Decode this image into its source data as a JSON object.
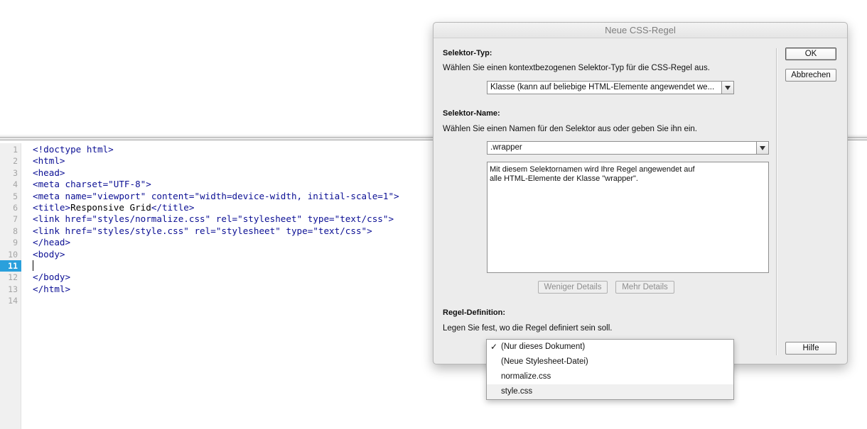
{
  "editor": {
    "line_numbers": [
      "1",
      "2",
      "3",
      "4",
      "5",
      "6",
      "7",
      "8",
      "9",
      "10",
      "11",
      "12",
      "13",
      "14"
    ],
    "current_line": "11",
    "lines": [
      [
        {
          "t": "tag",
          "v": "<!doctype html>"
        }
      ],
      [
        {
          "t": "tag",
          "v": "<html>"
        }
      ],
      [
        {
          "t": "tag",
          "v": "<head>"
        }
      ],
      [
        {
          "t": "tag",
          "v": "<meta charset="
        },
        {
          "t": "str",
          "v": "\"UTF-8\""
        },
        {
          "t": "tag",
          "v": ">"
        }
      ],
      [
        {
          "t": "tag",
          "v": "<meta name="
        },
        {
          "t": "str",
          "v": "\"viewport\""
        },
        {
          "t": "tag",
          "v": " content="
        },
        {
          "t": "str",
          "v": "\"width=device-width, initial-scale=1\""
        },
        {
          "t": "tag",
          "v": ">"
        }
      ],
      [
        {
          "t": "tag",
          "v": "<title>"
        },
        {
          "t": "text",
          "v": "Responsive Grid"
        },
        {
          "t": "tag",
          "v": "</title>"
        }
      ],
      [
        {
          "t": "tag",
          "v": "<link href="
        },
        {
          "t": "str",
          "v": "\"styles/normalize.css\""
        },
        {
          "t": "tag",
          "v": " rel="
        },
        {
          "t": "str",
          "v": "\"stylesheet\""
        },
        {
          "t": "tag",
          "v": " type="
        },
        {
          "t": "str",
          "v": "\"text/css\""
        },
        {
          "t": "tag",
          "v": ">"
        }
      ],
      [
        {
          "t": "tag",
          "v": "<link href="
        },
        {
          "t": "str",
          "v": "\"styles/style.css\""
        },
        {
          "t": "tag",
          "v": " rel="
        },
        {
          "t": "str",
          "v": "\"stylesheet\""
        },
        {
          "t": "tag",
          "v": " type="
        },
        {
          "t": "str",
          "v": "\"text/css\""
        },
        {
          "t": "tag",
          "v": ">"
        }
      ],
      [
        {
          "t": "tag",
          "v": "</head>"
        }
      ],
      [
        {
          "t": "tag",
          "v": "<body>"
        }
      ],
      [],
      [
        {
          "t": "tag",
          "v": "</body>"
        }
      ],
      [
        {
          "t": "tag",
          "v": "</html>"
        }
      ],
      []
    ]
  },
  "dialog": {
    "title": "Neue CSS-Regel",
    "selector_type": {
      "heading": "Selektor-Typ:",
      "description": "Wählen Sie einen kontextbezogenen Selektor-Typ für die CSS-Regel aus.",
      "selected": "Klasse (kann auf beliebige HTML-Elemente angewendet we..."
    },
    "selector_name": {
      "heading": "Selektor-Name:",
      "description": "Wählen Sie einen Namen für den Selektor aus oder geben Sie ihn ein.",
      "value": ".wrapper",
      "info": "Mit diesem Selektornamen wird Ihre Regel angewendet auf\nalle HTML-Elemente der Klasse \"wrapper\"."
    },
    "buttons": {
      "ok": "OK",
      "cancel": "Abbrechen",
      "less_details": "Weniger Details",
      "more_details": "Mehr Details",
      "help": "Hilfe"
    },
    "rule_definition": {
      "heading": "Regel-Definition:",
      "description": "Legen Sie fest, wo die Regel definiert sein soll.",
      "options": [
        {
          "label": "(Nur dieses Dokument)",
          "checked": true
        },
        {
          "label": "(Neue Stylesheet-Datei)",
          "checked": false
        },
        {
          "label": "normalize.css",
          "checked": false
        },
        {
          "label": "style.css",
          "checked": false
        }
      ],
      "check_glyph": "✓"
    }
  },
  "colors": {
    "code_tag": "#0b0f94",
    "code_text": "#000000",
    "current_line_bg": "#2aa0dc",
    "dialog_bg": "#ececec"
  }
}
